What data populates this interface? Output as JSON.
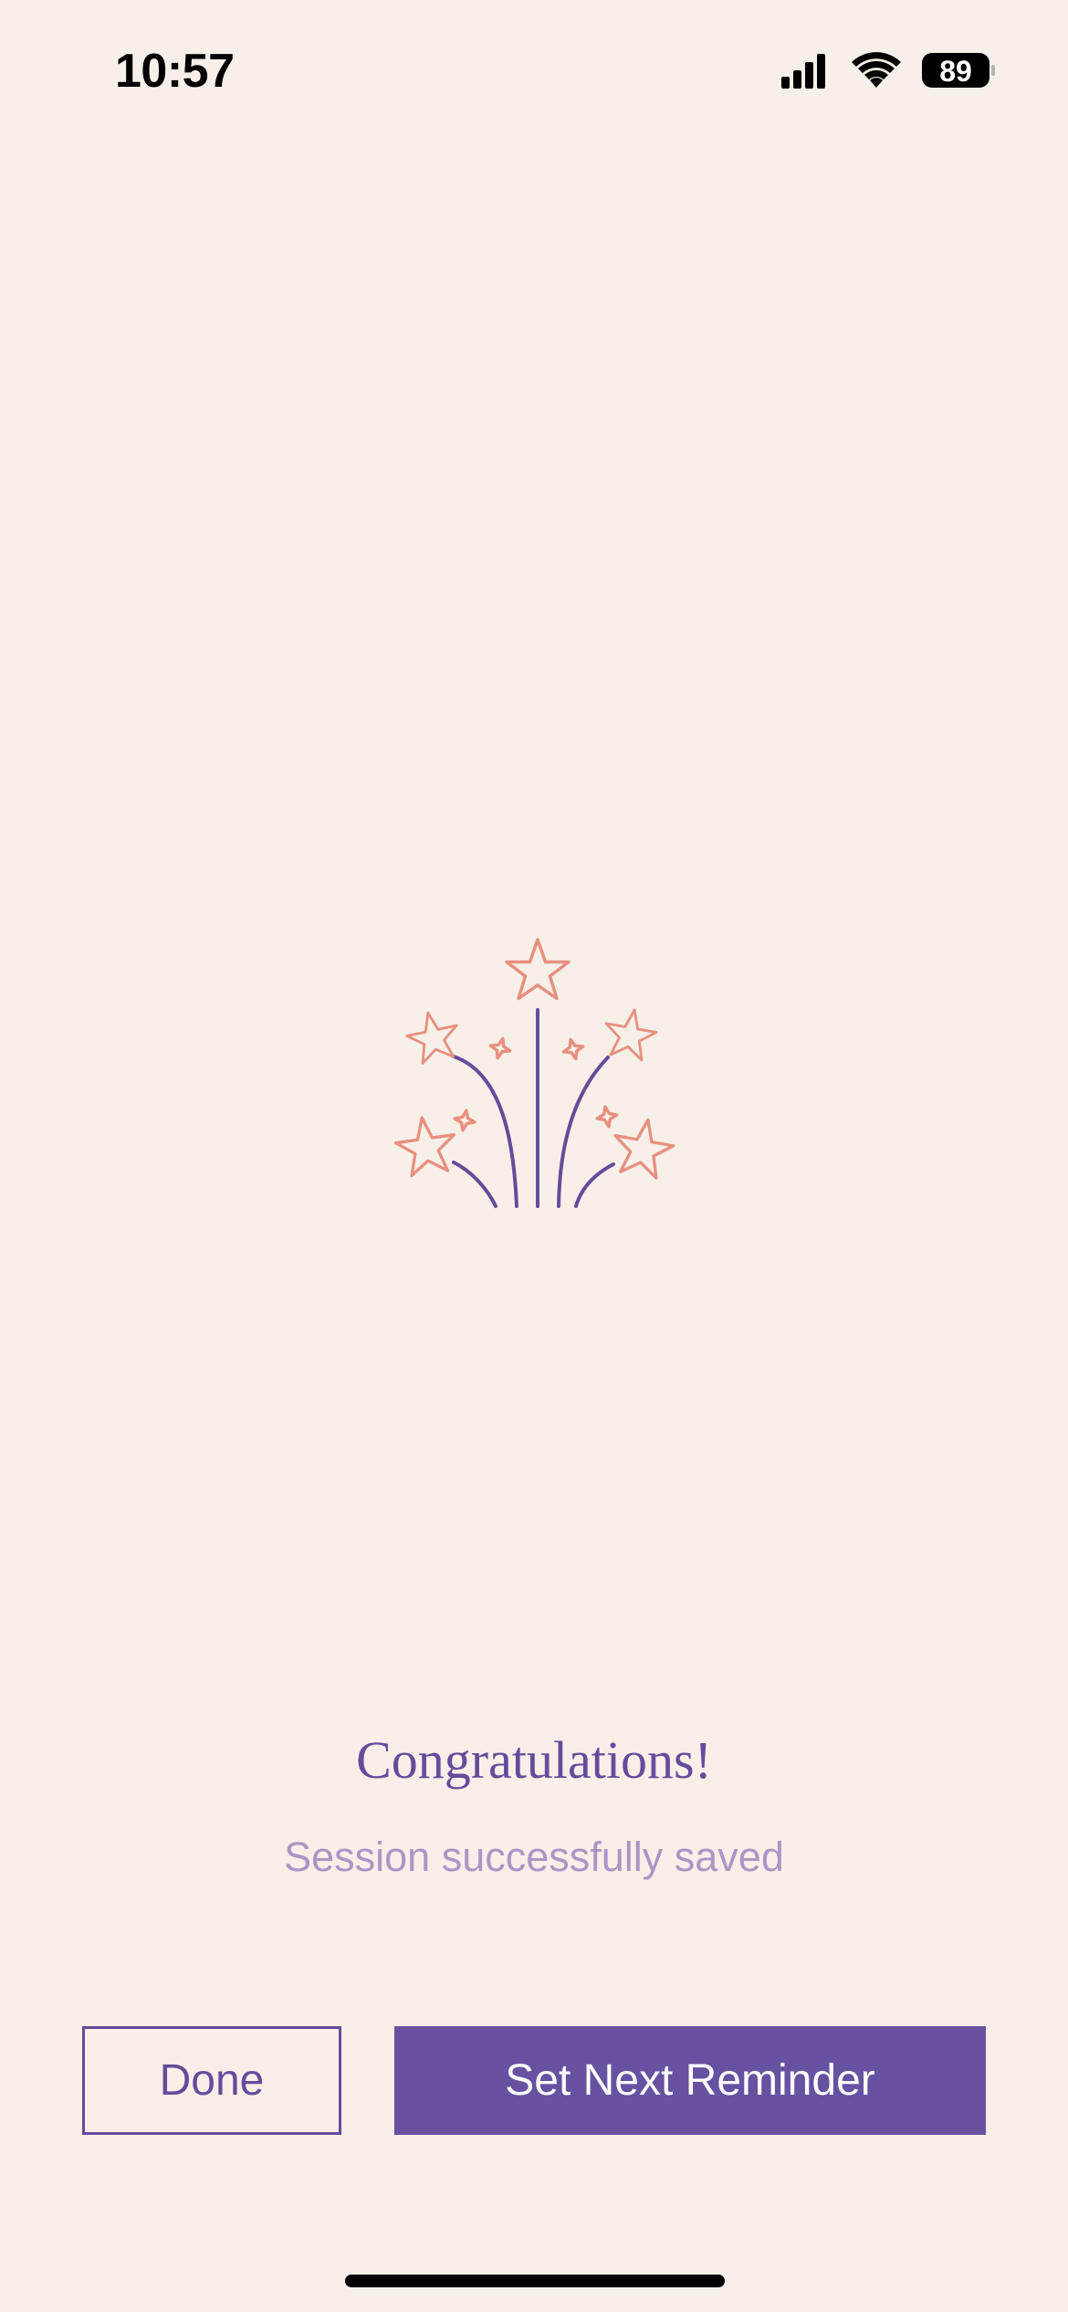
{
  "status_bar": {
    "time": "10:57",
    "battery_level": "89",
    "icons": [
      "cellular-signal-icon",
      "wifi-icon",
      "battery-icon"
    ]
  },
  "illustration": {
    "icon": "fireworks-icon",
    "colors": {
      "stars": "#e8907f",
      "trails": "#644c9c"
    }
  },
  "message": {
    "title": "Congratulations!",
    "subtitle": "Session successfully saved"
  },
  "actions": {
    "done_label": "Done",
    "reminder_label": "Set Next Reminder"
  },
  "theme": {
    "background": "#f7f0e8",
    "accent": "#6751a1",
    "subtitle_color": "#a897c6"
  }
}
